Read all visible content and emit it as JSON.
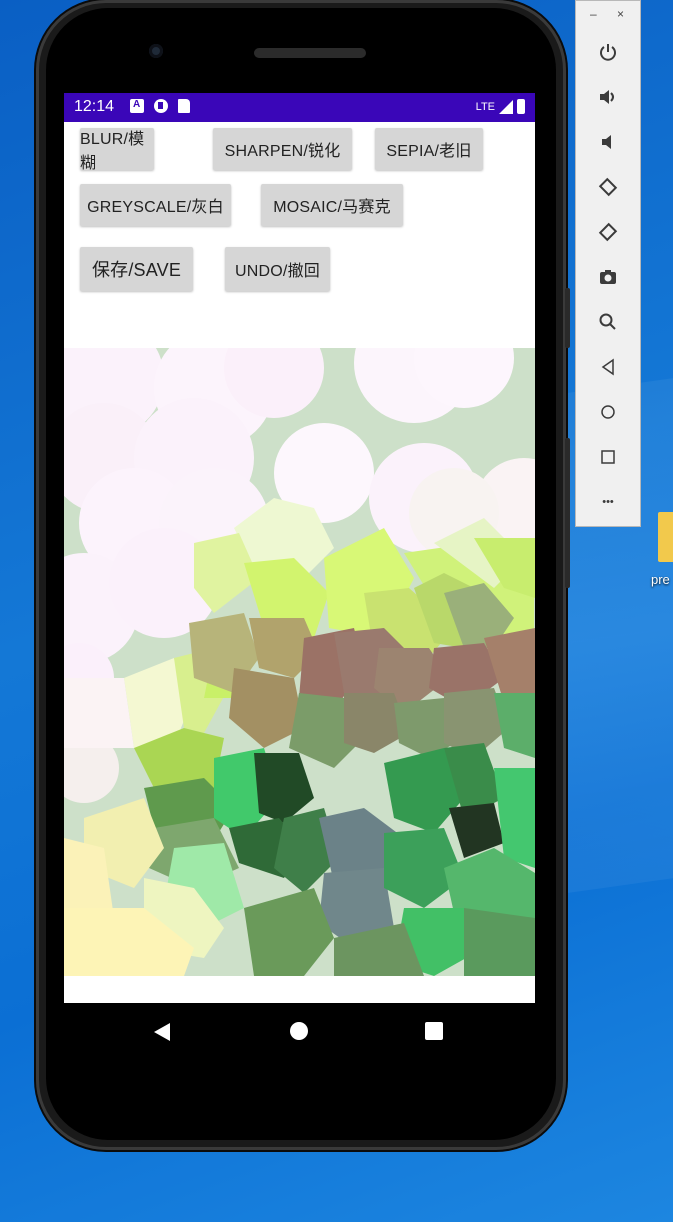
{
  "status_bar": {
    "time": "12:14",
    "network": "LTE"
  },
  "buttons": {
    "blur": "BLUR/模糊",
    "sharpen": "SHARPEN/锐化",
    "sepia": "SEPIA/老旧",
    "greyscale": "GREYSCALE/灰白",
    "mosaic": "MOSAIC/马赛克",
    "save": "保存/SAVE",
    "undo": "UNDO/撤回"
  },
  "image": {
    "effect": "mosaic (voronoi)"
  },
  "nav": {
    "back_icon": "triangle-back-icon",
    "home_icon": "circle-home-icon",
    "recents_icon": "square-recents-icon"
  },
  "emulator_toolbar": {
    "minimize": "–",
    "close": "×",
    "more": "•••",
    "items": [
      "power-icon",
      "volume-up-icon",
      "volume-down-icon",
      "rotate-left-icon",
      "rotate-right-icon",
      "screenshot-icon",
      "zoom-icon",
      "back-icon",
      "home-icon",
      "overview-icon",
      "more-icon"
    ]
  },
  "desktop": {
    "icon_label": "pre"
  },
  "colors": {
    "status_bar": "#3a06b8",
    "button_bg": "#d6d6d6"
  }
}
